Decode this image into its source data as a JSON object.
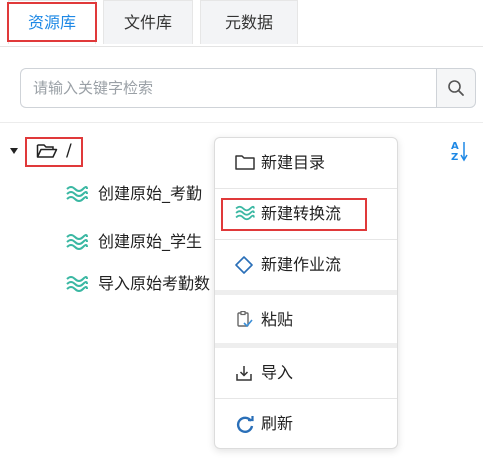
{
  "tabs": [
    {
      "label": "资源库",
      "active": true
    },
    {
      "label": "文件库",
      "active": false
    },
    {
      "label": "元数据",
      "active": false
    }
  ],
  "search": {
    "placeholder": "请输入关键字检索",
    "value": ""
  },
  "tree": {
    "root_label": "/",
    "items": [
      {
        "label": "创建原始_考勤"
      },
      {
        "label": "创建原始_学生"
      },
      {
        "label": "导入原始考勤数"
      }
    ]
  },
  "context_menu": {
    "new_directory": "新建目录",
    "new_transform_flow": "新建转换流",
    "new_job_flow": "新建作业流",
    "paste": "粘贴",
    "import": "导入",
    "refresh": "刷新"
  },
  "colors": {
    "accent": "#1e88e5",
    "highlight_border": "#e0393a",
    "flow_icon": "#3bb8a3"
  }
}
